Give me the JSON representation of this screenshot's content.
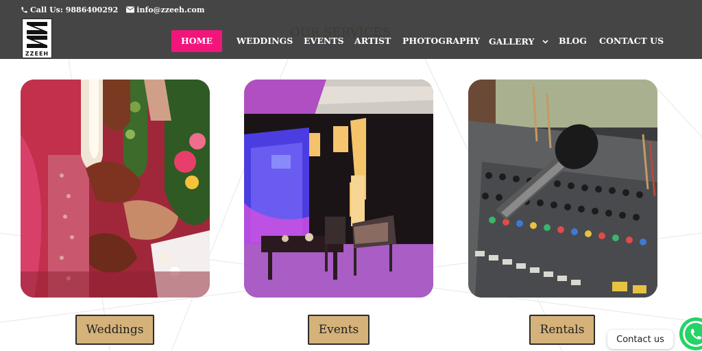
{
  "header": {
    "phone_label": "Call Us: 9886400292",
    "email_label": "info@zzeeh.com",
    "logo_text": "ZZEEH",
    "bg_color": "#454545"
  },
  "nav": {
    "items": [
      {
        "label": "HOME",
        "active": true
      },
      {
        "label": "WEDDINGS"
      },
      {
        "label": "EVENTS"
      },
      {
        "label": "ARTIST"
      },
      {
        "label": "PHOTOGRAPHY"
      },
      {
        "label": "GALLERY",
        "has_dropdown": true
      },
      {
        "label": "BLOG"
      },
      {
        "label": "CONTACT US"
      }
    ],
    "active_color": "#f2157c"
  },
  "section": {
    "title": "OUR SERVICES"
  },
  "services": [
    {
      "label": "Weddings",
      "image": "wedding-ceremony-photo"
    },
    {
      "label": "Events",
      "image": "event-stage-photo"
    },
    {
      "label": "Rentals",
      "image": "audio-mixer-microphone-photo"
    }
  ],
  "button_color": "#d4b27a",
  "chat": {
    "label": "Contact us",
    "icon": "whatsapp-icon",
    "color": "#25d366"
  }
}
